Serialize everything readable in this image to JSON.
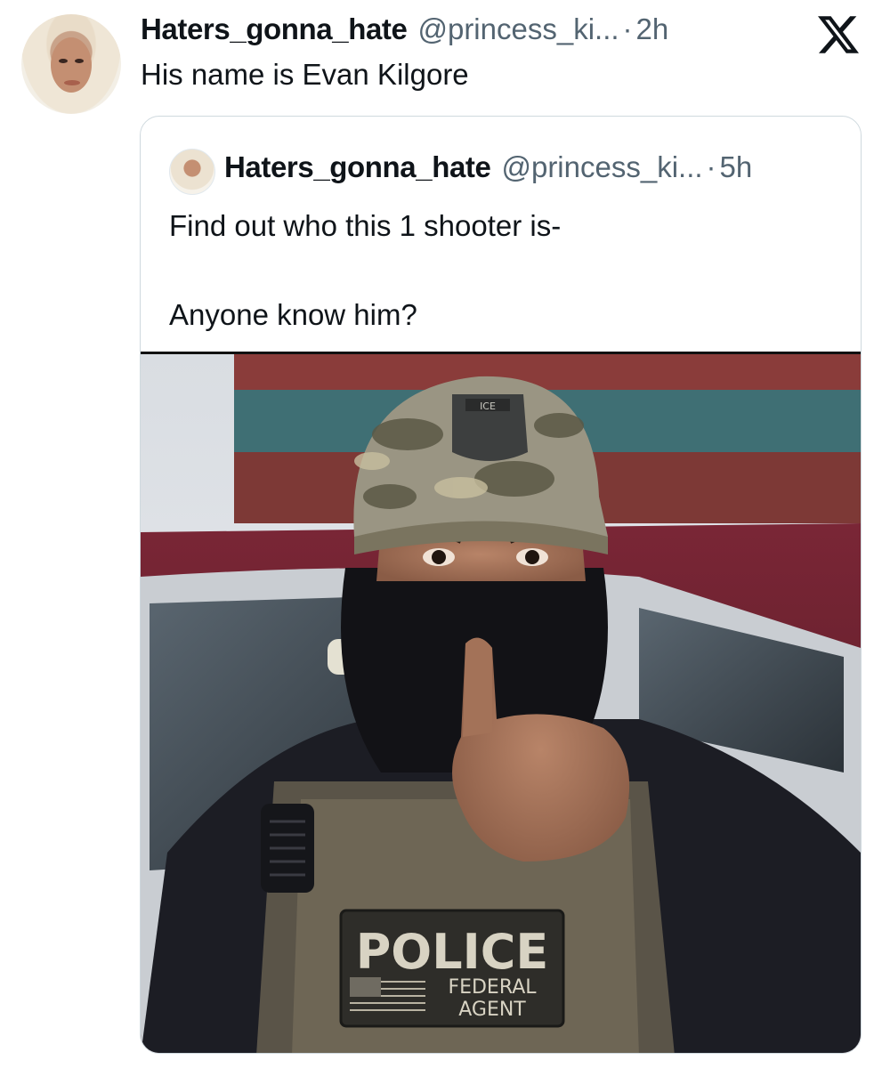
{
  "post": {
    "display_name": "Haters_gonna_hate",
    "handle": "@princess_ki...",
    "separator": "·",
    "time": "2h",
    "text": "His name is Evan Kilgore"
  },
  "close_icon": "x-icon",
  "quoted_post": {
    "display_name": "Haters_gonna_hate",
    "handle": "@princess_ki...",
    "separator": "·",
    "time": "5h",
    "text": "Find out who this 1 shooter is-\n\nAnyone know him?"
  },
  "photo": {
    "vest_patch_main": "POLICE",
    "vest_patch_line1": "FEDERAL",
    "vest_patch_line2": "AGENT",
    "cap_patch": "ICE"
  },
  "colors": {
    "text_primary": "#0f1419",
    "text_secondary": "#536471",
    "border": "#cfd9de"
  }
}
